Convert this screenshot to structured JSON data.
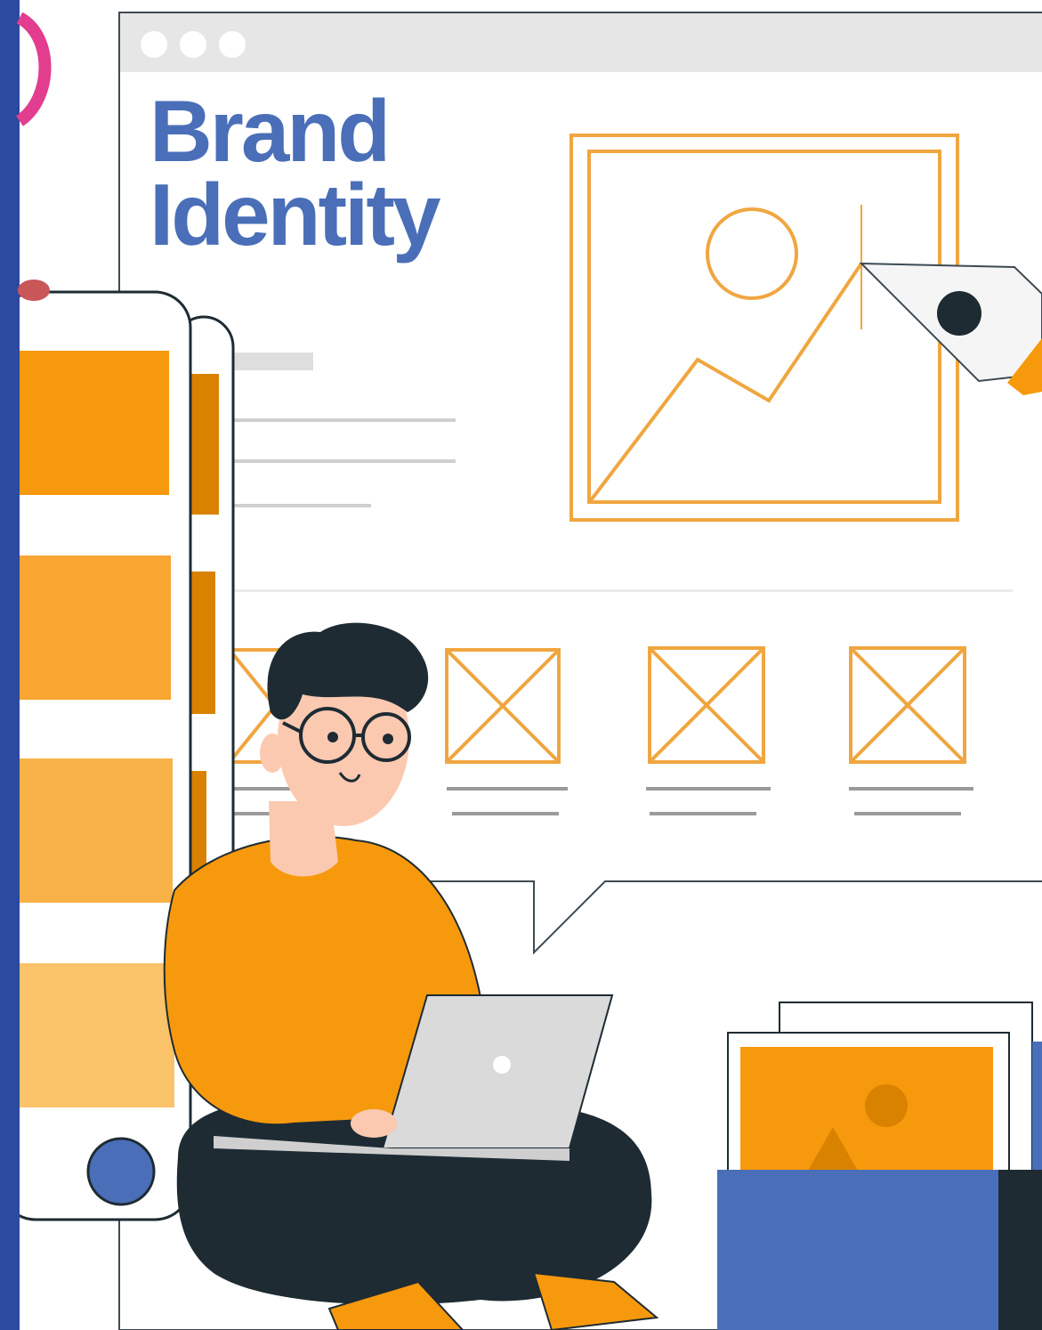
{
  "heading": {
    "line1": "Brand",
    "line2": "Identity"
  },
  "colors": {
    "left_bar": "#2c4aa0",
    "brand_blue": "#4a6fb8",
    "accent_orange": "#f7990c",
    "orange_light": "#f9b247",
    "orange_dark": "#d98200",
    "outline_dark": "#1e2b33",
    "skin": "#fbc9b0",
    "laptop_gray": "#dadada",
    "wire_gray": "#e6e6e6"
  },
  "icons": [
    "window-dots-icon",
    "image-placeholder-icon",
    "pen-tool-icon",
    "x-box-placeholder-icon",
    "laptop-icon",
    "photo-icon"
  ]
}
